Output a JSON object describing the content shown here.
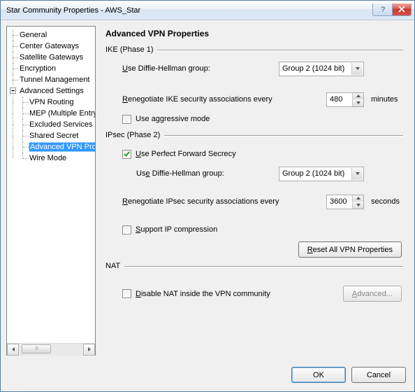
{
  "window": {
    "title": "Star Community Properties - AWS_Star"
  },
  "tree": {
    "items": [
      "General",
      "Center Gateways",
      "Satellite Gateways",
      "Encryption",
      "Tunnel Management"
    ],
    "advanced_label": "Advanced Settings",
    "children": [
      "VPN Routing",
      "MEP (Multiple Entry Point)",
      "Excluded Services",
      "Shared Secret",
      "Advanced VPN Properties",
      "Wire Mode"
    ],
    "selected_index": 4
  },
  "page": {
    "title": "Advanced VPN Properties",
    "ike": {
      "header": "IKE (Phase 1)",
      "dh_label_pre": "U",
      "dh_label_post": "se Diffie-Hellman group:",
      "dh_value": "Group  2 (1024 bit)",
      "reneg_pre": "R",
      "reneg_post": "enegotiate IKE security associations every",
      "reneg_value": "480",
      "reneg_unit": "minutes",
      "aggressive_label": "Use aggressive mode",
      "aggressive_checked": false
    },
    "ipsec": {
      "header": "IPsec (Phase 2)",
      "pfs_pre": "U",
      "pfs_post": "se Perfect Forward Secrecy",
      "pfs_checked": true,
      "dh2_label_pre": "Us",
      "dh2_label_u": "e",
      "dh2_label_post": " Diffie-Hellman group:",
      "dh2_value": "Group  2 (1024 bit)",
      "reneg2_pre": "R",
      "reneg2_post": "enegotiate IPsec security associations every",
      "reneg2_value": "3600",
      "reneg2_unit": "seconds",
      "compress_pre": "S",
      "compress_post": "upport IP compression",
      "compress_checked": false,
      "reset_btn_pre": "R",
      "reset_btn_post": "eset All VPN Properties"
    },
    "nat": {
      "header": "NAT",
      "disable_pre": "D",
      "disable_post": "isable NAT inside the VPN community",
      "disable_checked": false,
      "adv_btn_pre": "A",
      "adv_btn_post": "dvanced..."
    }
  },
  "footer": {
    "ok": "OK",
    "cancel": "Cancel"
  }
}
